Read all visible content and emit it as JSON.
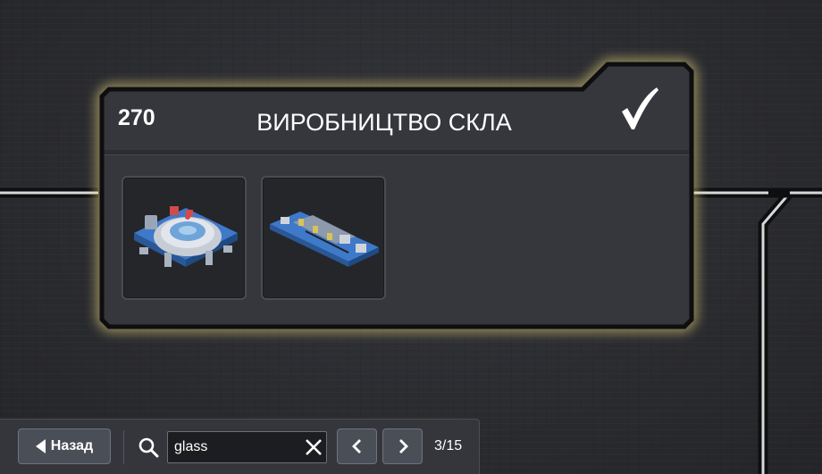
{
  "card": {
    "level": "270",
    "title": "ВИРОБНИЦТВО СКЛА",
    "completed": true,
    "buildings": [
      {
        "icon": "glass-furnace-building-icon"
      },
      {
        "icon": "glass-assembly-line-building-icon"
      }
    ]
  },
  "toolbar": {
    "back_label": "Назад",
    "search_value": "glass",
    "page_counter": "3/15"
  },
  "colors": {
    "card_glow": "#e8d27a",
    "card_border": "#0d0e10",
    "card_fill": "#35373d",
    "button": "#4a4e57",
    "connector_line": "#d8d8d8"
  }
}
